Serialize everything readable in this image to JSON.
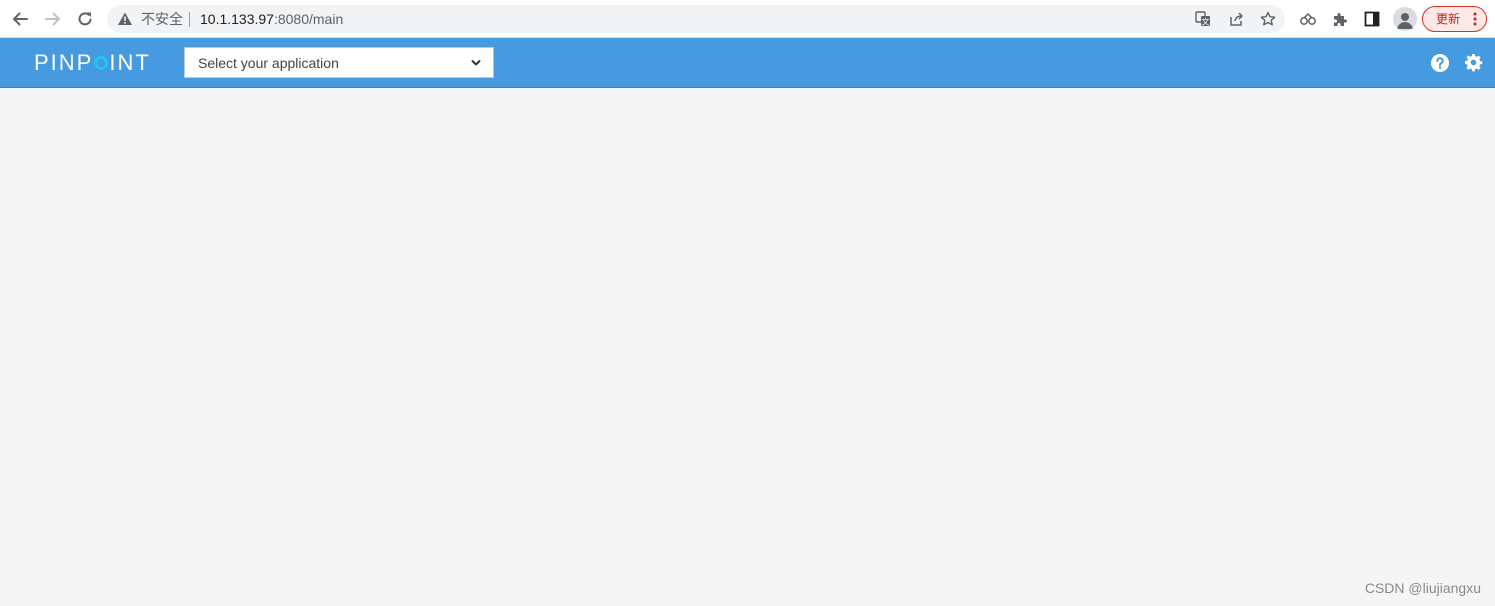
{
  "browser": {
    "security_label": "不安全",
    "url_host": "10.1.133.97",
    "url_rest": ":8080/main",
    "update_label": "更新"
  },
  "header": {
    "logo_left": "PINP",
    "logo_right": "INT",
    "app_select_placeholder": "Select your application"
  },
  "watermark": "CSDN @liujiangxu",
  "colors": {
    "header_bg": "#469ae0",
    "logo_accent": "#1ec5f7",
    "page_bg": "#f5f5f5",
    "update_red": "#d93025"
  }
}
